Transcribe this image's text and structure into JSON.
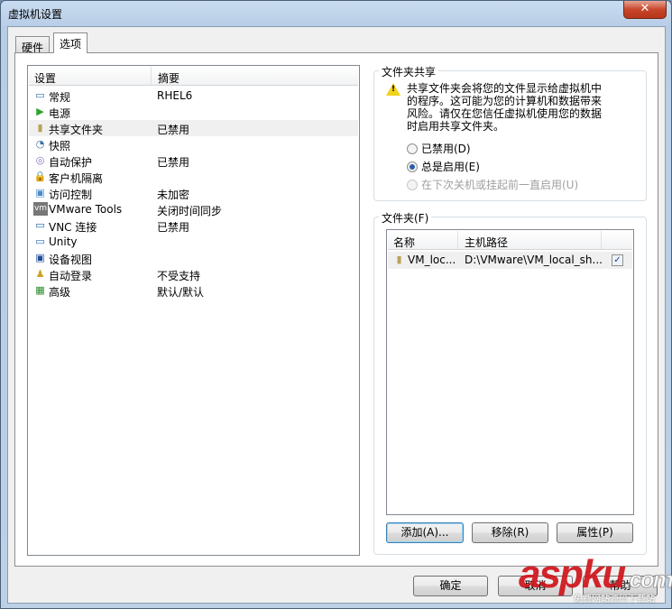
{
  "window": {
    "title": "虚拟机设置",
    "close": "✕"
  },
  "tabs": [
    {
      "label": "硬件"
    },
    {
      "label": "选项"
    }
  ],
  "settings": {
    "headers": [
      "设置",
      "摘要"
    ],
    "rows": [
      {
        "name": "常规",
        "summary": "RHEL6",
        "icon": "monitor-icon"
      },
      {
        "name": "电源",
        "summary": "",
        "icon": "play-icon"
      },
      {
        "name": "共享文件夹",
        "summary": "已禁用",
        "icon": "folder-icon"
      },
      {
        "name": "快照",
        "summary": "",
        "icon": "snapshot-icon"
      },
      {
        "name": "自动保护",
        "summary": "已禁用",
        "icon": "autoprotect-icon"
      },
      {
        "name": "客户机隔离",
        "summary": "",
        "icon": "lock-icon"
      },
      {
        "name": "访问控制",
        "summary": "未加密",
        "icon": "access-control-icon"
      },
      {
        "name": "VMware Tools",
        "summary": "关闭时间同步",
        "icon": "vm-icon"
      },
      {
        "name": "VNC 连接",
        "summary": "已禁用",
        "icon": "vnc-icon"
      },
      {
        "name": "Unity",
        "summary": "",
        "icon": "unity-icon"
      },
      {
        "name": "设备视图",
        "summary": "",
        "icon": "device-view-icon"
      },
      {
        "name": "自动登录",
        "summary": "不受支持",
        "icon": "users-key-icon"
      },
      {
        "name": "高级",
        "summary": "默认/默认",
        "icon": "advanced-icon"
      }
    ]
  },
  "sharing": {
    "label": "文件夹共享",
    "warning": "共享文件夹会将您的文件显示给虚拟机中的程序。这可能为您的计算机和数据带来风险。请仅在您信任虚拟机使用您的数据时启用共享文件夹。",
    "options": [
      {
        "label": "已禁用(D)",
        "checked": false,
        "disabled": false
      },
      {
        "label": "总是启用(E)",
        "checked": true,
        "disabled": false
      },
      {
        "label": "在下次关机或挂起前一直启用(U)",
        "checked": false,
        "disabled": true
      }
    ]
  },
  "folders": {
    "label": "文件夹(F)",
    "headers": [
      "名称",
      "主机路径"
    ],
    "rows": [
      {
        "name": "VM_loc...",
        "path": "D:\\VMware\\VM_local_sh...",
        "enabled": true
      }
    ],
    "buttons": {
      "add": "添加(A)...",
      "remove": "移除(R)",
      "properties": "属性(P)"
    }
  },
  "footer": {
    "ok": "确定",
    "cancel": "取消",
    "help": "帮助"
  },
  "watermark": {
    "logo": "aspku",
    "suffix": ".com",
    "tagline": "免费网站源码下载站"
  }
}
